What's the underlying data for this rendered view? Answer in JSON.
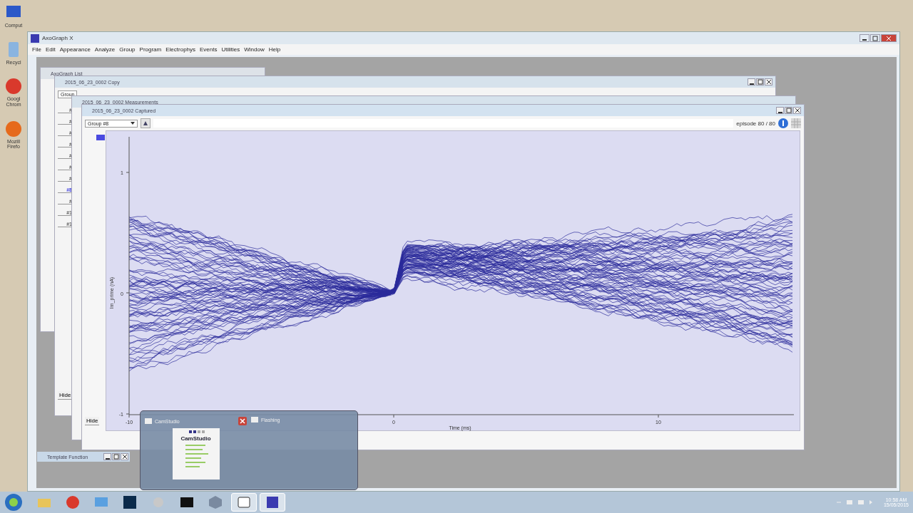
{
  "desktop": {
    "icons": [
      {
        "label": "Comput",
        "kind": "computer"
      },
      {
        "label": "Recycl",
        "kind": "bin"
      },
      {
        "label": "Googl Chrom",
        "kind": "chrome"
      },
      {
        "label": "Mozill Firefo",
        "kind": "firefox"
      }
    ]
  },
  "app": {
    "title": "AxoGraph X",
    "menu": [
      "File",
      "Edit",
      "Appearance",
      "Analyze",
      "Group",
      "Program",
      "Electrophys",
      "Events",
      "Utilities",
      "Window",
      "Help"
    ]
  },
  "list_window": {
    "title": "AxoGraph List"
  },
  "copy_window": {
    "title": "2015_06_23_0002 Copy",
    "group": "Group",
    "items": [
      {
        "label": "#",
        "selected": false
      },
      {
        "label": "#",
        "selected": false
      },
      {
        "label": "#",
        "selected": false
      },
      {
        "label": "#",
        "selected": false
      },
      {
        "label": "#",
        "selected": false
      },
      {
        "label": "#",
        "selected": false
      },
      {
        "label": "#",
        "selected": false
      },
      {
        "label": "#8",
        "selected": true
      },
      {
        "label": "#",
        "selected": false
      },
      {
        "label": "#1",
        "selected": false
      },
      {
        "label": "#1",
        "selected": false
      }
    ],
    "hide": "Hide"
  },
  "measurements_window": {
    "title": "2015_06_23_0002 Measurements"
  },
  "captured_window": {
    "title": "2015_06_23_0002 Captured",
    "hide": "Hide",
    "group": "Group #8",
    "episode": "episode 80 / 80",
    "xlabel": "Time (ms)",
    "ylabel": "Im_prime (nA)",
    "xticks": [
      "-10",
      "0",
      "10"
    ],
    "yticks": [
      "1",
      "0",
      "-1"
    ]
  },
  "template_window": {
    "title": "Template Function"
  },
  "preview": {
    "items": [
      {
        "title": "CamStudio",
        "closable": true
      },
      {
        "title": "Flashing",
        "closable": false
      }
    ],
    "thumb_title": "CamStudio"
  },
  "taskbar": {
    "apps": [
      {
        "kind": "folder",
        "active": false
      },
      {
        "kind": "chrome",
        "active": false
      },
      {
        "kind": "monitor",
        "active": false
      },
      {
        "kind": "ps",
        "active": false
      },
      {
        "kind": "tool",
        "active": false
      },
      {
        "kind": "terminal",
        "active": false
      },
      {
        "kind": "box",
        "active": false
      },
      {
        "kind": "window",
        "active": true
      },
      {
        "kind": "axo",
        "active": true
      }
    ],
    "time": "10:58 AM",
    "date": "15/05/2015"
  }
}
